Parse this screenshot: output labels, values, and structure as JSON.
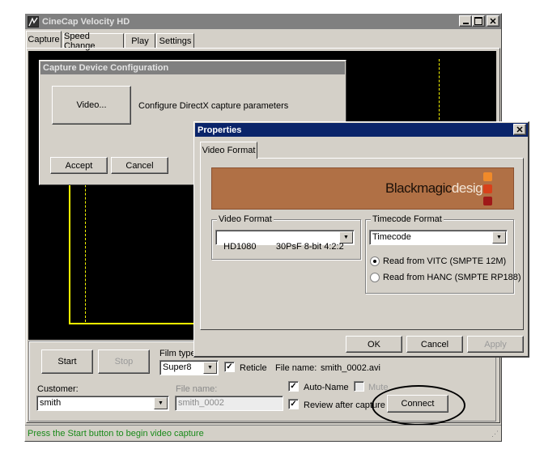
{
  "main_window": {
    "title": "CineCap Velocity HD",
    "tabs": [
      "Capture",
      "Speed Change",
      "Play",
      "Settings"
    ],
    "buttons": {
      "start": "Start",
      "stop": "Stop",
      "connect": "Connect"
    },
    "film_type": {
      "label": "Film type:",
      "value": "Super8"
    },
    "reticle": {
      "label": "Reticle",
      "checked": true
    },
    "file_name_display": {
      "label": "File name:",
      "value": "smith_0002.avi"
    },
    "customer": {
      "label": "Customer:",
      "value": "smith"
    },
    "file_name_field": {
      "label": "File name:",
      "value": "smith_0002"
    },
    "auto_name": {
      "label": "Auto-Name",
      "checked": true
    },
    "mute": {
      "label": "Mute",
      "checked": false
    },
    "review": {
      "label": "Review after capture",
      "checked": true
    },
    "status": "Press the Start button to begin video capture",
    "colors": {
      "status_text": "#1a8a1a",
      "preview_bg": "#000000",
      "guide_line": "#ffff00",
      "highlight_circle": "#000000"
    }
  },
  "capture_dialog": {
    "title": "Capture Device Configuration",
    "video_button": "Video...",
    "description": "Configure DirectX capture parameters",
    "accept": "Accept",
    "cancel": "Cancel"
  },
  "properties_dialog": {
    "title": "Properties",
    "tab": "Video Format",
    "banner": {
      "brand_main": "Blackmagic",
      "brand_sub": "design",
      "bg_color": "#b07045"
    },
    "video_format": {
      "legend": "Video Format",
      "value": "HD1080        30PsF 8-bit 4:2:2"
    },
    "timecode_format": {
      "legend": "Timecode Format",
      "value": "Timecode",
      "options": [
        {
          "label": "Read from VITC (SMPTE 12M)",
          "selected": true
        },
        {
          "label": "Read from HANC (SMPTE RP188)",
          "selected": false
        }
      ]
    },
    "buttons": {
      "ok": "OK",
      "cancel": "Cancel",
      "apply": "Apply"
    }
  }
}
